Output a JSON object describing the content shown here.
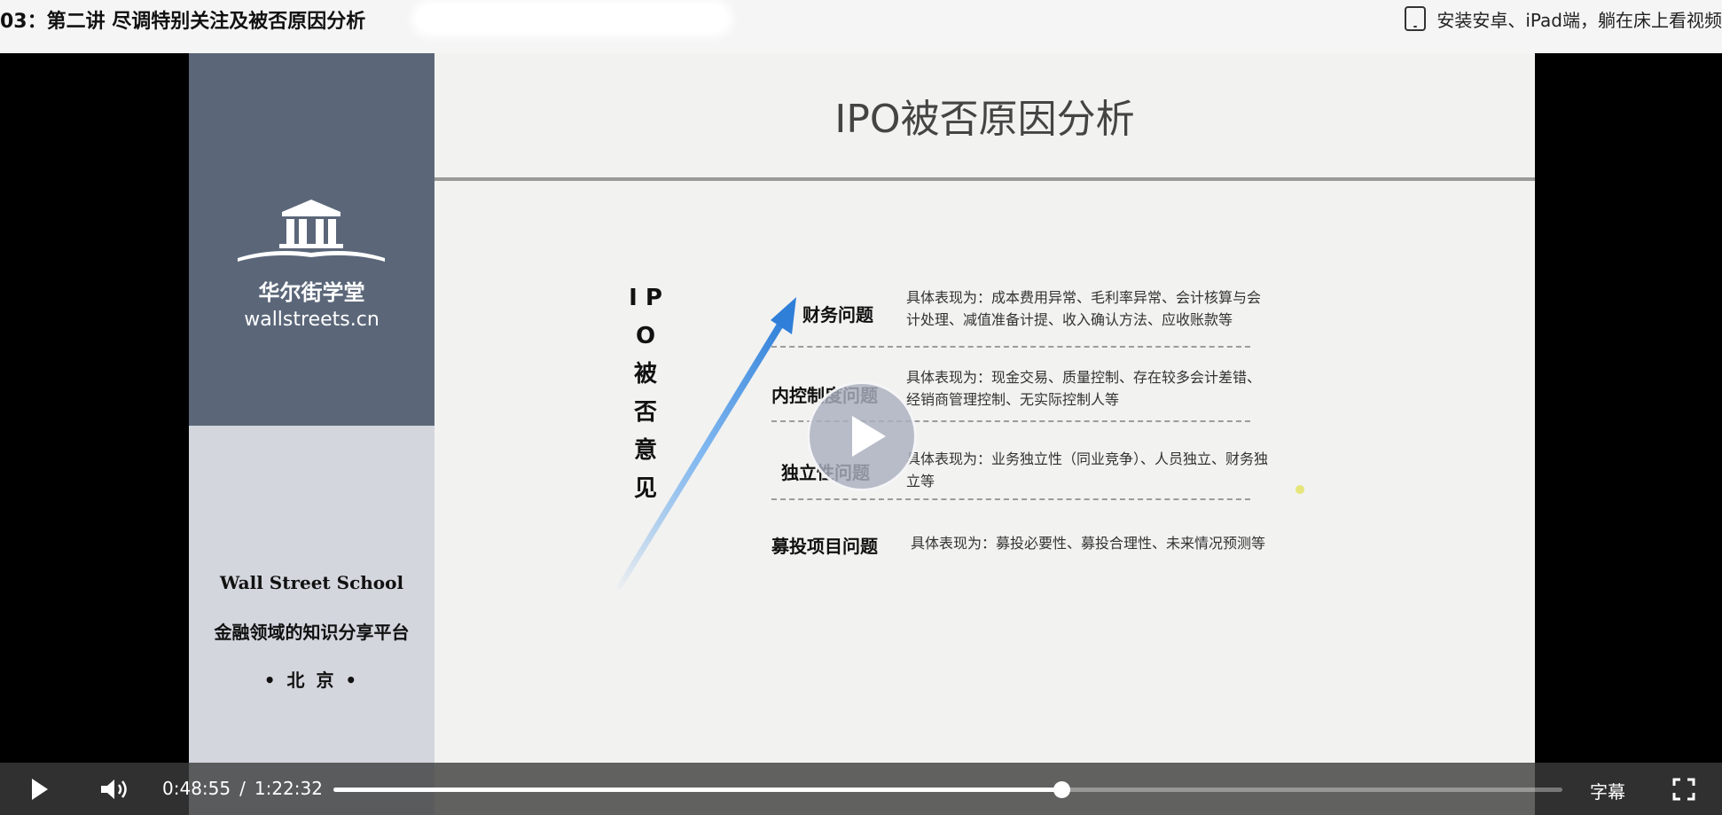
{
  "header": {
    "title": "03：第二讲 尽调特别关注及被否原因分析",
    "promo_text": "安装安卓、iPad端，躺在床上看视频",
    "promo_icon": "tablet-icon"
  },
  "slide": {
    "brand_cn": "华尔街学堂",
    "brand_en": "wallstreets.cn",
    "school_en": "Wall Street School",
    "platform": "金融领域的知识分享平台",
    "city": "• 北 京 •",
    "title": "IPO被否原因分析",
    "vertical_label": [
      "I P",
      "O",
      "被",
      "否",
      "意",
      "见"
    ],
    "rows": [
      {
        "title": "财务问题",
        "desc": "具体表现为：成本费用异常、毛利率异常、会计核算与会计处理、减值准备计提、收入确认方法、应收账款等"
      },
      {
        "title": "内控制度问题",
        "desc": "具体表现为：现金交易、质量控制、存在较多会计差错、经销商管理控制、无实际控制人等"
      },
      {
        "title": "独立性问题",
        "desc": "具体表现为：业务独立性（同业竞争）、人员独立、财务独立等"
      },
      {
        "title": "募投项目问题",
        "desc": "具体表现为：募投必要性、募投合理性、未来情况预测等"
      }
    ]
  },
  "player": {
    "current_time": "0:48:55",
    "separator": "/",
    "duration": "1:22:32",
    "progress_fraction": 0.5926,
    "subtitle_label": "字幕",
    "colors": {
      "bar": "#3c3c3c",
      "slide_dark": "#5b6779",
      "slide_light": "#d3d6dd",
      "arrow": "#3f8fe0"
    }
  }
}
